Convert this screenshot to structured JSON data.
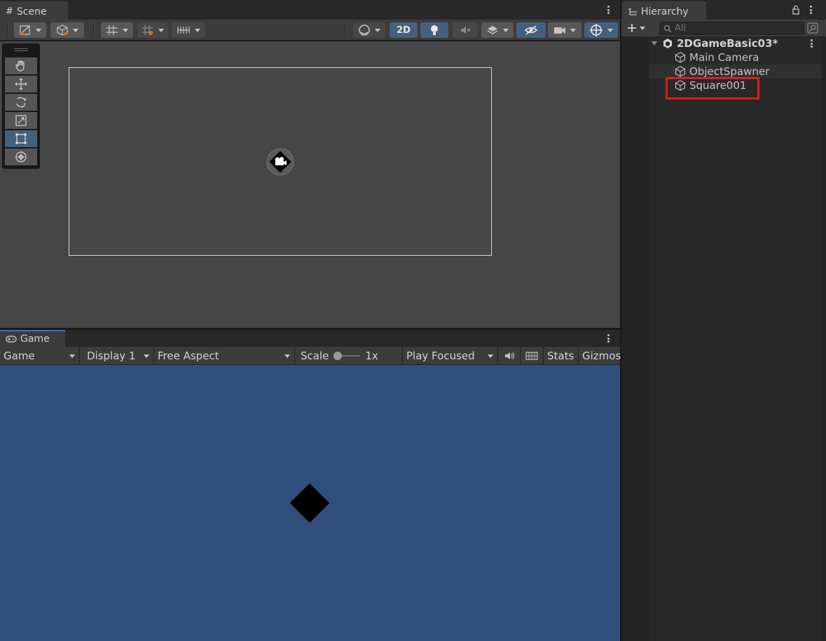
{
  "scene": {
    "tab_label": "Scene",
    "toolbar": {
      "mode_2d_label": "2D"
    }
  },
  "game": {
    "tab_label": "Game",
    "view_dropdown": "Game",
    "display_dropdown": "Display 1",
    "aspect_dropdown": "Free Aspect",
    "scale_label": "Scale",
    "scale_value": "1x",
    "play_mode_dropdown": "Play Focused",
    "stats_label": "Stats",
    "gizmos_label": "Gizmos"
  },
  "hierarchy": {
    "tab_label": "Hierarchy",
    "search_placeholder": "All",
    "scene_name": "2DGameBasic03*",
    "items": [
      {
        "label": "Main Camera"
      },
      {
        "label": "ObjectSpawner"
      },
      {
        "label": "Square001"
      }
    ]
  },
  "colors": {
    "scene_background": "#464646",
    "game_background": "#304f7c",
    "highlight": "#e11b22",
    "selected_button": "#46607c"
  }
}
